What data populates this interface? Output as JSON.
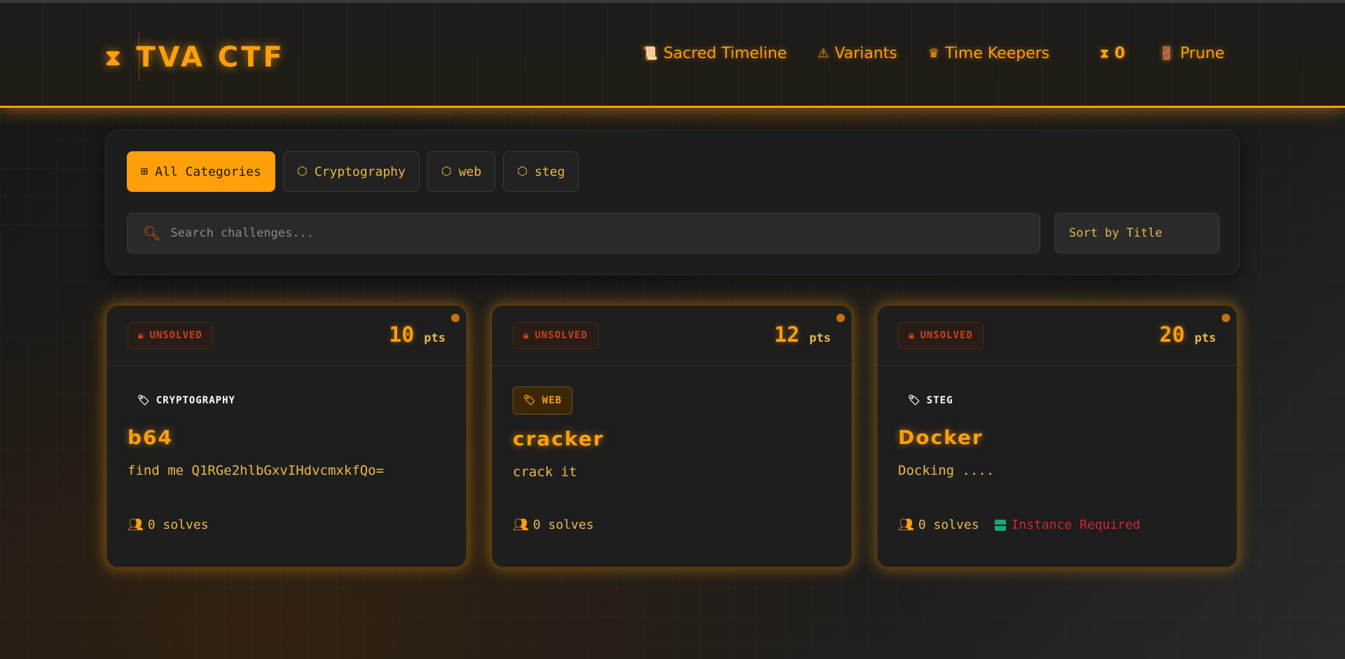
{
  "header": {
    "brand": "TVA CTF",
    "brand_icon": "hourglass-icon",
    "nav": [
      {
        "label": "Sacred Timeline",
        "icon": "scroll-icon"
      },
      {
        "label": "Variants",
        "icon": "warning-icon"
      },
      {
        "label": "Time Keepers",
        "icon": "crown-icon"
      }
    ],
    "score": "0",
    "prune_label": "Prune"
  },
  "filters": {
    "tabs": [
      {
        "label": "All Categories",
        "icon": "grid-icon",
        "active": true
      },
      {
        "label": "Cryptography",
        "icon": "cube-icon"
      },
      {
        "label": "web",
        "icon": "cube-icon"
      },
      {
        "label": "steg",
        "icon": "cube-icon"
      }
    ],
    "search_placeholder": "Search challenges...",
    "sort_label": "Sort by Title"
  },
  "challenges": [
    {
      "status": "UNSOLVED",
      "points": "10",
      "points_unit": "pts",
      "category": "CRYPTOGRAPHY",
      "title": "b64",
      "description": "find me Q1RGe2hlbGxvIHdvcmxkfQo=",
      "solves": "0 solves"
    },
    {
      "status": "UNSOLVED",
      "points": "12",
      "points_unit": "pts",
      "category": "WEB",
      "title": "cracker",
      "description": "crack it",
      "solves": "0 solves"
    },
    {
      "status": "UNSOLVED",
      "points": "20",
      "points_unit": "pts",
      "category": "STEG",
      "title": "Docker",
      "description": "Docking ....",
      "solves": "0 solves",
      "instance": "Instance Required"
    }
  ],
  "colors": {
    "accent": "#ff9f0a",
    "unsolved": "#c8441a",
    "instance": "#d8223a",
    "background": "#1a1a1a"
  }
}
